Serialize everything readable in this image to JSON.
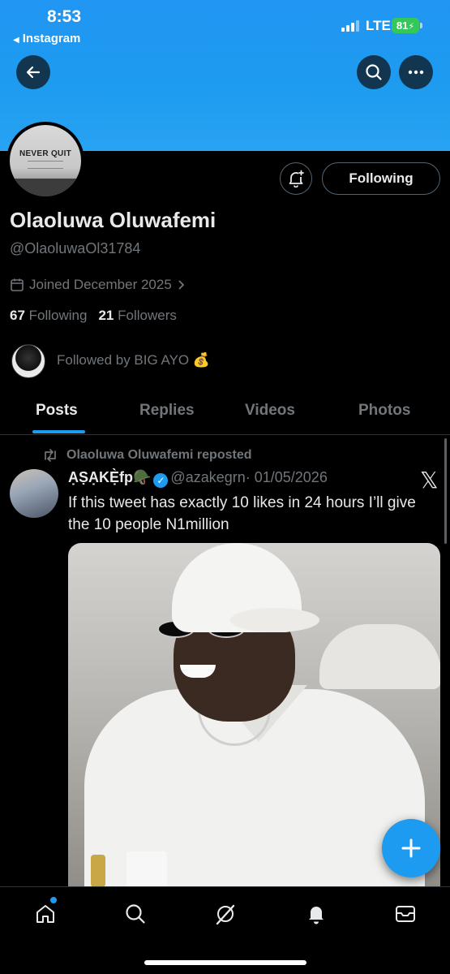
{
  "status_bar": {
    "time": "8:53",
    "back_app": "Instagram",
    "network": "LTE",
    "battery": "81"
  },
  "profile": {
    "name": "Olaoluwa Oluwafemi",
    "handle": "@OlaoluwaOl31784",
    "joined": "Joined December 2025",
    "following_count": "67",
    "following_label": "Following",
    "followers_count": "21",
    "followers_label": "Followers",
    "followed_by": "Followed by BIG AYO 💰",
    "follow_button": "Following",
    "avatar_text": "NEVER QUIT"
  },
  "tabs": [
    "Posts",
    "Replies",
    "Videos",
    "Photos"
  ],
  "post": {
    "repost_label": "Olaoluwa Oluwafemi reposted",
    "author_name": "ẠṢẠKẸ̀fp🪖",
    "author_handle": "@azakegrn",
    "date": "· 01/05/2026",
    "text": "If this tweet has exactly 10 likes in 24 hours I’ll give the 10 people N1million"
  },
  "icons": {
    "back": "arrow-left-icon",
    "search": "search-icon",
    "more": "more-icon",
    "bell": "bell-plus-icon",
    "repost": "repost-icon",
    "verified": "verified-badge-icon",
    "x": "x-logo-icon",
    "compose": "plus-icon"
  },
  "colors": {
    "accent": "#1d9bf0",
    "banner": "#1d9bf0",
    "background": "#000000",
    "muted": "#71767b"
  }
}
